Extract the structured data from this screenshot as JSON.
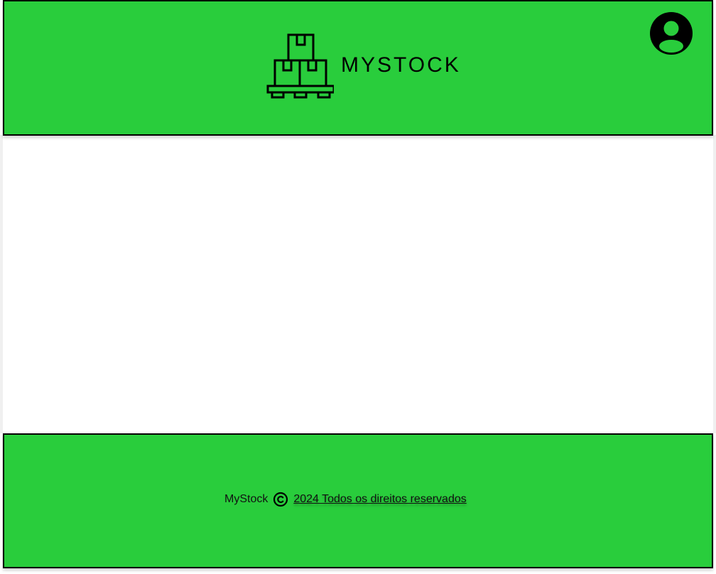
{
  "header": {
    "brand": "MYSTOCK",
    "logo_icon": "stacked-boxes-pallet-icon",
    "avatar_icon": "user-avatar-icon"
  },
  "footer": {
    "brand": "MyStock",
    "copyright_icon": "copyright-icon",
    "rights_text": "2024 Todos os direitos reservados"
  },
  "colors": {
    "primary_green": "#29cd3c",
    "border": "#000000",
    "background": "#ffffff"
  }
}
